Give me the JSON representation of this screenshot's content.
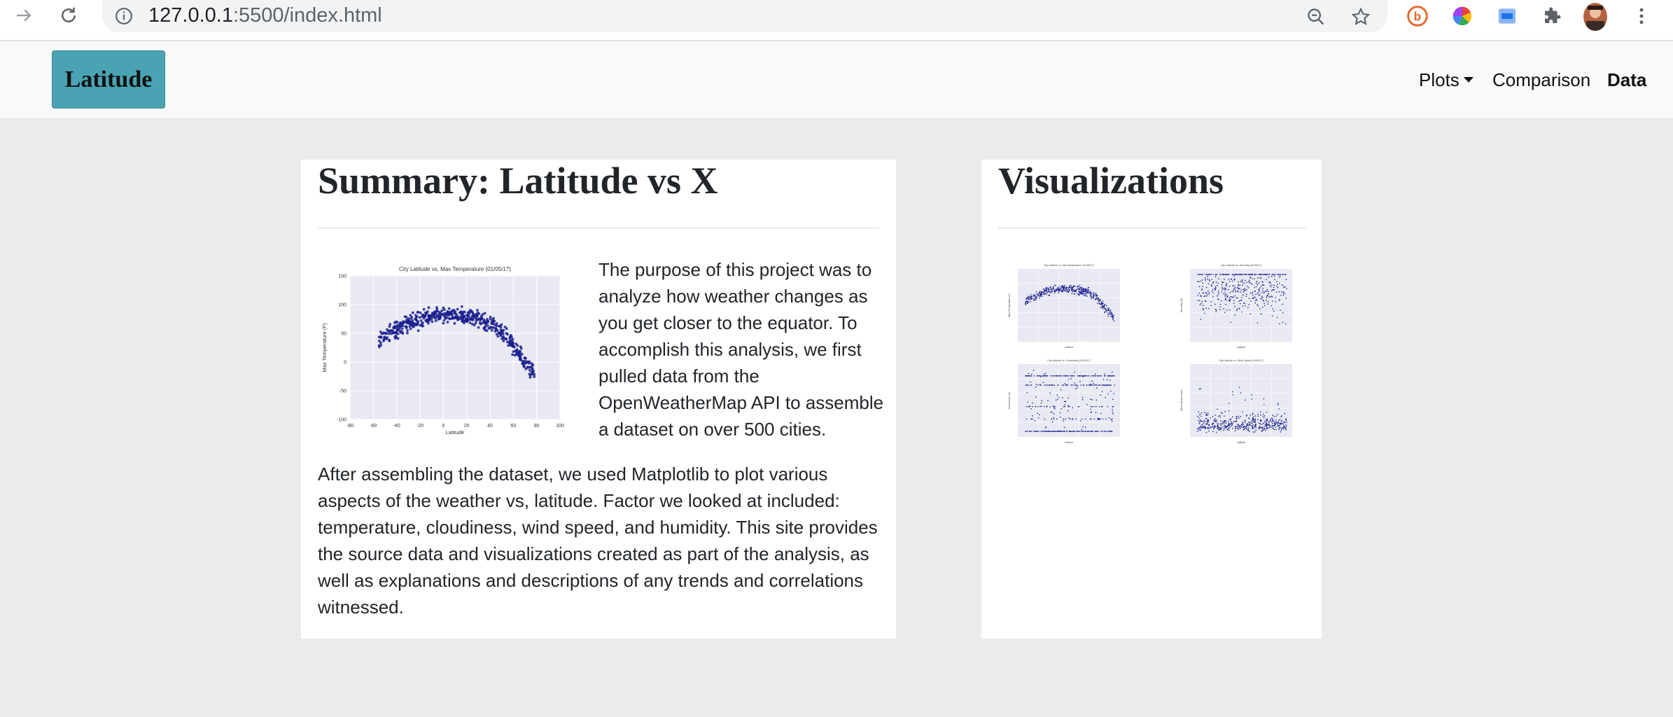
{
  "browser": {
    "url_host": "127.0.0.1",
    "url_rest": ":5500/index.html",
    "icons": [
      "forward-arrow-icon",
      "reload-icon",
      "site-info-icon",
      "zoom-out-icon",
      "bookmark-star-icon",
      "extension-b-icon",
      "color-wheel-icon",
      "docs-extension-icon",
      "puzzle-extensions-icon",
      "profile-avatar",
      "menu-dots-icon"
    ]
  },
  "navbar": {
    "brand": "Latitude",
    "items": [
      {
        "label": "Plots"
      },
      {
        "label": "Comparison"
      },
      {
        "label": "Data"
      }
    ]
  },
  "summary": {
    "title": "Summary: Latitude vs X",
    "intro_text": "The purpose of this project was to analyze how weather changes as you get closer to the equator. To accomplish this analysis, we first pulled data from the OpenWeatherMap API to assemble a dataset on over 500 cities.",
    "body_text": "After assembling the dataset, we used Matplotlib to plot various aspects of the weather vs, latitude. Factor we looked at included: temperature, cloudiness, wind speed, and humidity. This site provides the source data and visualizations created as part of the analysis, as well as explanations and descriptions of any trends and correlations witnessed."
  },
  "visualizations": {
    "title": "Visualizations"
  },
  "chart_data": [
    {
      "type": "scatter",
      "title": "City Latitude vs. Max Temperature (01/05/17)",
      "xlabel": "Latitude",
      "ylabel": "Max Temperature (F)",
      "xlim": [
        -80,
        100
      ],
      "ylim": [
        -100,
        150
      ],
      "xticks": [
        "-80",
        "-60",
        "-40",
        "-20",
        "0",
        "20",
        "40",
        "60",
        "80",
        "100"
      ],
      "yticks": [
        "150",
        "100",
        "50",
        "0",
        "-50",
        "-100"
      ],
      "point_color": "#1a1f8c",
      "background": "#e8e9f2",
      "grid": true,
      "trend": "max temperature peaks near latitude 0-20 (about 80-85 F) and falls toward -60 F near latitude 75"
    },
    {
      "type": "scatter",
      "title": "City Latitude vs. Max Temperature (01/05/17)",
      "xlabel": "Latitude",
      "ylabel": "Max Temperature (F)",
      "point_color": "#1a1f8c",
      "pattern": "temperature"
    },
    {
      "type": "scatter",
      "title": "City Latitude vs. Humidity (01/05/17)",
      "xlabel": "Latitude",
      "ylabel": "Humidity (%)",
      "point_color": "#1a1f8c",
      "pattern": "humidity"
    },
    {
      "type": "scatter",
      "title": "City Latitude vs. Cloudiness (01/05/17)",
      "xlabel": "Latitude",
      "ylabel": "Cloudiness (%)",
      "point_color": "#1a1f8c",
      "pattern": "cloudiness"
    },
    {
      "type": "scatter",
      "title": "City Latitude vs. Wind Speed (01/05/17)",
      "xlabel": "Latitude",
      "ylabel": "Wind Speed (mph)",
      "point_color": "#1a1f8c",
      "pattern": "wind"
    }
  ]
}
